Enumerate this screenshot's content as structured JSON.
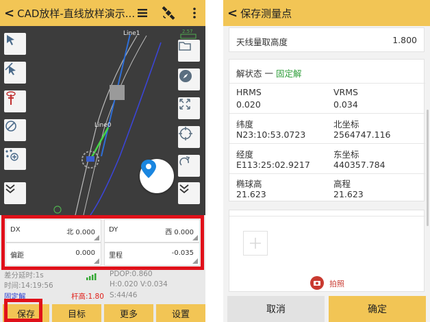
{
  "left_screen": {
    "title": "CAD放样-直线放样演示...",
    "back_glyph": "<",
    "map": {
      "line1_label": "Line1",
      "line0_label": "Line0",
      "scale_text": "2.57"
    },
    "panel": {
      "dx": {
        "label": "DX",
        "value": "北 0.000"
      },
      "dy": {
        "label": "DY",
        "value": "西 0.000"
      },
      "offset": {
        "label": "偏距",
        "value": "0.000"
      },
      "mileage": {
        "label": "里程",
        "value": "-0.035"
      }
    },
    "status": {
      "diff_delay": "差分延时:1s",
      "pdop": "PDOP:0.860",
      "time": "时间:14:19:56",
      "hv": "H:0.020  V:0.034",
      "fix": "固定解",
      "pole": "杆高:1.80",
      "sats": "S:44/46"
    },
    "buttons": {
      "save": "保存",
      "target": "目标",
      "more": "更多",
      "settings": "设置"
    }
  },
  "right_screen": {
    "title": "保存测量点",
    "back_glyph": "<",
    "antenna": {
      "label": "天线量取高度",
      "value": "1.800"
    },
    "solution": {
      "prefix": "解状态 一 ",
      "value": "固定解"
    },
    "fields": [
      {
        "label": "HRMS",
        "value": "0.020"
      },
      {
        "label": "VRMS",
        "value": "0.034"
      },
      {
        "label": "纬度",
        "value": "N23:10:53.0723"
      },
      {
        "label": "北坐标",
        "value": "2564747.116"
      },
      {
        "label": "经度",
        "value": "E113:25:02.9217"
      },
      {
        "label": "东坐标",
        "value": "440357.784"
      },
      {
        "label": "椭球高",
        "value": "21.623"
      },
      {
        "label": "高程",
        "value": "21.623"
      }
    ],
    "photo_label": "拍照",
    "cancel": "取消",
    "confirm": "确定"
  },
  "colors": {
    "accent_yellow": "#f2c555",
    "fix_green": "#2f9e3a",
    "highlight_red": "#e0101a",
    "fab_blue": "#1a86e0",
    "pole_red": "#e0201a",
    "fix_blue": "#2a3fd0"
  },
  "icons": [
    "back-icon",
    "list-icon",
    "satellite-icon",
    "more-vert-icon",
    "select-arrow-icon",
    "pick-point-icon",
    "pole-icon",
    "no-entry-icon",
    "points-add-icon",
    "collapse-icon",
    "folder-icon",
    "compass-icon",
    "fullscreen-icon",
    "target-icon",
    "rotate-icon",
    "location-pin-icon",
    "signal-icon",
    "add-photo-icon",
    "camera-icon"
  ]
}
